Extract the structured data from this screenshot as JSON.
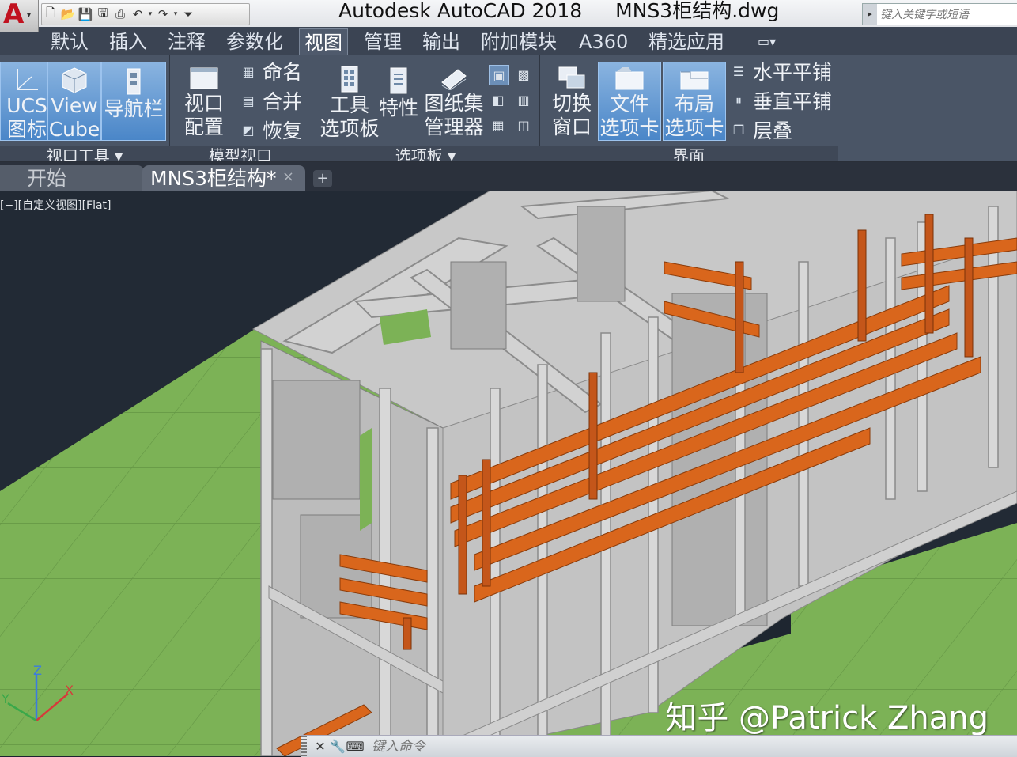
{
  "app": {
    "logo_letter": "A",
    "name": "Autodesk AutoCAD 2018",
    "file_name": "MNS3柜结构.dwg"
  },
  "search": {
    "placeholder": "键入关键字或短语"
  },
  "quick_access_icons": [
    "new-icon",
    "open-icon",
    "save-icon",
    "saveas-icon",
    "plot-icon",
    "undo-icon",
    "redo-icon",
    "customize-icon"
  ],
  "ribbon_tabs": [
    {
      "label": "默认"
    },
    {
      "label": "插入"
    },
    {
      "label": "注释"
    },
    {
      "label": "参数化"
    },
    {
      "label": "视图",
      "active": true
    },
    {
      "label": "管理"
    },
    {
      "label": "输出"
    },
    {
      "label": "附加模块"
    },
    {
      "label": "A360"
    },
    {
      "label": "精选应用"
    }
  ],
  "ribbon_extra_icon": "minimize-ribbon-icon",
  "panels": {
    "viewport_tools": {
      "title": "视口工具 ▾",
      "buttons": [
        {
          "label": "UCS",
          "sub": "图标",
          "icon": "ucs-icon"
        },
        {
          "label": "View",
          "sub": "Cube",
          "icon": "viewcube-icon"
        },
        {
          "label": "导航栏",
          "icon": "navbar-icon"
        }
      ]
    },
    "model_viewports": {
      "title": "模型视口",
      "config_label": "视口",
      "config_sub": "配置",
      "items": [
        {
          "label": "命名",
          "icon": "named-viewports-icon"
        },
        {
          "label": "合并",
          "icon": "join-icon"
        },
        {
          "label": "恢复",
          "icon": "restore-icon"
        }
      ]
    },
    "palettes": {
      "title": "选项板 ▾",
      "buttons": [
        {
          "label": "工具",
          "sub": "选项板",
          "icon": "tool-palettes-icon"
        },
        {
          "label": "特性",
          "icon": "properties-icon"
        },
        {
          "label": "图纸集",
          "sub": "管理器",
          "icon": "sheetset-icon"
        }
      ]
    },
    "interface": {
      "title": "界面",
      "switch_label": "切换",
      "switch_sub": "窗口",
      "buttons": [
        {
          "label": "文件",
          "sub": "选项卡",
          "icon": "file-tabs-icon"
        },
        {
          "label": "布局",
          "sub": "选项卡",
          "icon": "layout-tabs-icon"
        }
      ],
      "items": [
        {
          "label": "水平平铺",
          "icon": "tile-horizontal-icon"
        },
        {
          "label": "垂直平铺",
          "icon": "tile-vertical-icon"
        },
        {
          "label": "层叠",
          "icon": "cascade-icon"
        }
      ]
    }
  },
  "doc_tabs": {
    "start_label": "开始",
    "current_label": "MNS3柜结构*",
    "close_glyph": "×",
    "new_glyph": "+"
  },
  "viewport": {
    "label": "[−][自定义视图][Flat]",
    "watermark": "知乎 @Patrick Zhang",
    "axes": {
      "z": "Z",
      "x": "X",
      "y": "Y"
    }
  },
  "command_line": {
    "placeholder": "键入命令",
    "icons": [
      "close-icon",
      "wrench-icon",
      "prompt-icon"
    ]
  },
  "colors": {
    "ground": "#7cb256",
    "frame": "#b9b9b9",
    "busbar": "#d9661c",
    "background": "#222a35"
  }
}
